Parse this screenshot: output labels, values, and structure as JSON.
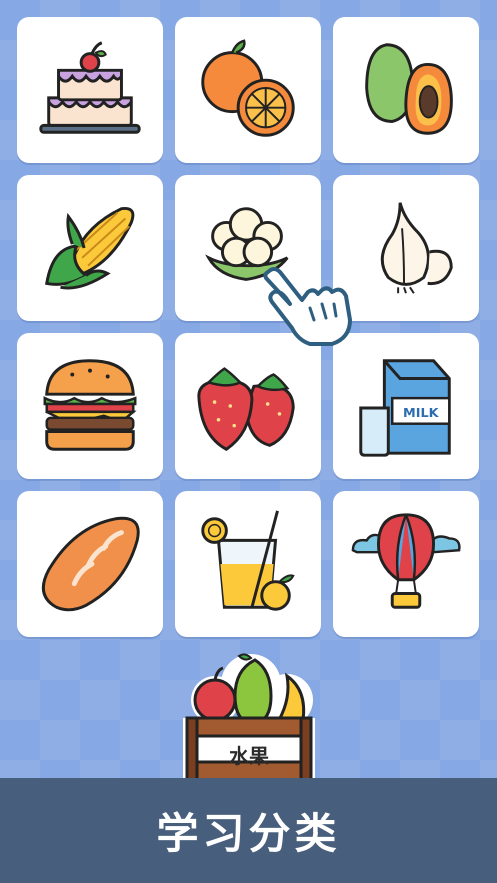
{
  "tiles": [
    {
      "icon": "cake-icon"
    },
    {
      "icon": "orange-icon"
    },
    {
      "icon": "papaya-icon"
    },
    {
      "icon": "corn-icon"
    },
    {
      "icon": "cauliflower-icon"
    },
    {
      "icon": "garlic-icon"
    },
    {
      "icon": "burger-icon"
    },
    {
      "icon": "strawberry-icon"
    },
    {
      "icon": "milk-icon"
    },
    {
      "icon": "bread-icon"
    },
    {
      "icon": "juice-icon"
    },
    {
      "icon": "hot-air-balloon-icon"
    }
  ],
  "pointer": {
    "icon": "hand-pointer-icon"
  },
  "category": {
    "label": "水果",
    "icon": "fruit-crate-icon"
  },
  "footer": {
    "title": "学习分类"
  },
  "colors": {
    "background": "#86a8e4",
    "footer_bar": "#485e7d",
    "tile": "#ffffff"
  }
}
